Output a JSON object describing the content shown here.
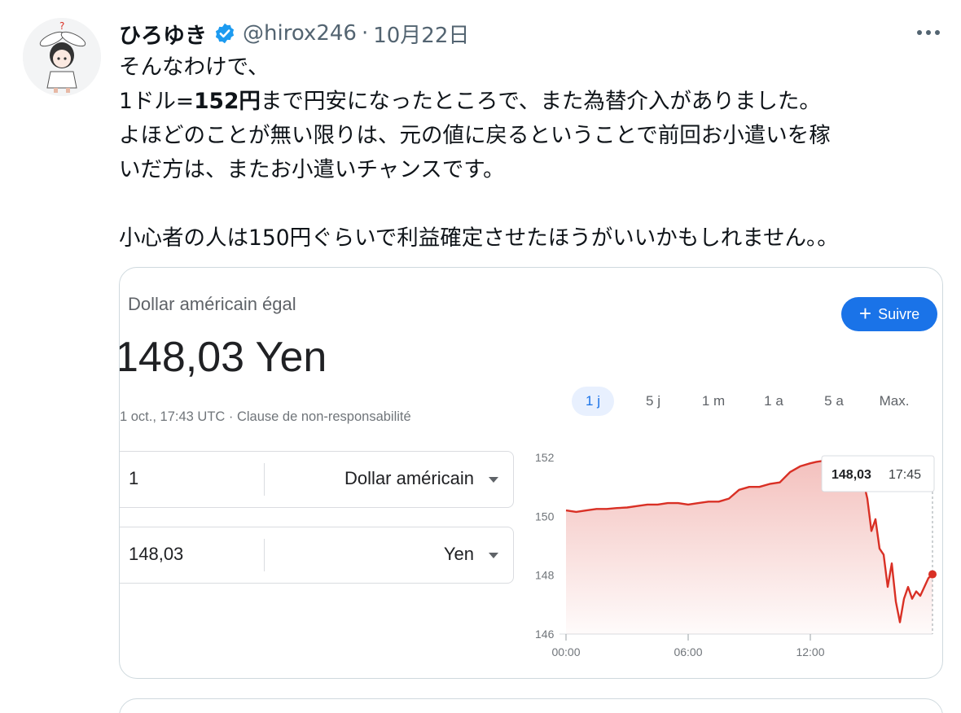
{
  "tweet": {
    "display_name": "ひろゆき",
    "handle": "@hirox246",
    "separator": "·",
    "date": "10月22日",
    "lines": [
      "そんなわけで、",
      "1ドル=",
      "152円",
      "まで円安になったところで、また為替介入がありました。",
      "よほどのことが無い限りは、元の値に戻るということで前回お小遣いを稼",
      "いだ方は、またお小遣いチャンスです。",
      "小心者の人は150円ぐらいで利益確定させたほうがいいかもしれません。。"
    ]
  },
  "fx_card": {
    "caption": "Dollar américain égal",
    "rate_text": "148,03 Yen",
    "timestamp": "1 oct., 17:43 UTC · Clause de non-responsabilité",
    "follow_label": "Suivre",
    "converter": [
      {
        "amount": "1",
        "unit": "Dollar américain"
      },
      {
        "amount": "148,03",
        "unit": "Yen"
      }
    ],
    "ranges": [
      "1 j",
      "5 j",
      "1 m",
      "1 a",
      "5 a",
      "Max."
    ],
    "active_range": "1 j",
    "tooltip": {
      "value": "148,03",
      "time": "17:45"
    }
  },
  "chart_data": {
    "type": "area",
    "x_ticks": [
      "00:00",
      "06:00",
      "12:00"
    ],
    "y_ticks": [
      146,
      148,
      150,
      152
    ],
    "ylim": [
      146,
      152
    ],
    "x_range_hours": [
      0,
      18
    ],
    "x": [
      0,
      0.5,
      1,
      1.5,
      2,
      2.5,
      3,
      3.5,
      4,
      4.5,
      5,
      5.5,
      6,
      6.5,
      7,
      7.5,
      8,
      8.5,
      9,
      9.5,
      10,
      10.5,
      11,
      11.5,
      12,
      12.3,
      12.6,
      13,
      13.5,
      14,
      14.3,
      14.6,
      14.8,
      15,
      15.2,
      15.4,
      15.6,
      15.8,
      16,
      16.2,
      16.4,
      16.6,
      16.8,
      17,
      17.2,
      17.4,
      17.6,
      17.8,
      18
    ],
    "values": [
      150.2,
      150.15,
      150.2,
      150.25,
      150.25,
      150.28,
      150.3,
      150.35,
      150.4,
      150.4,
      150.45,
      150.45,
      150.4,
      150.45,
      150.5,
      150.5,
      150.6,
      150.9,
      151.0,
      151.0,
      151.1,
      151.15,
      151.5,
      151.7,
      151.8,
      151.85,
      151.88,
      151.85,
      151.9,
      151.85,
      151.6,
      151.2,
      150.6,
      149.5,
      149.9,
      148.9,
      148.7,
      147.6,
      148.4,
      147.1,
      146.4,
      147.2,
      147.6,
      147.2,
      147.45,
      147.3,
      147.6,
      147.9,
      148.03
    ],
    "series_color": "#d93025",
    "grid": false
  }
}
